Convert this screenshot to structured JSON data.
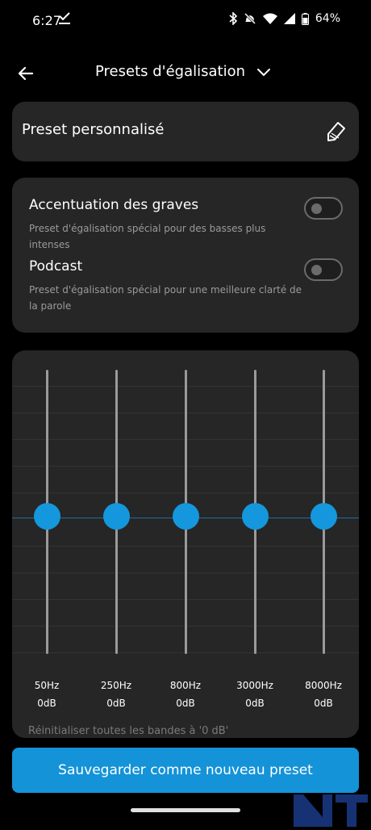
{
  "status_bar": {
    "time": "6:27",
    "battery": "64%"
  },
  "header": {
    "title": "Presets d'égalisation"
  },
  "preset": {
    "label": "Preset personnalisé"
  },
  "toggles": [
    {
      "title": "Accentuation des graves",
      "description": "Preset d'égalisation spécial pour des basses plus intenses",
      "on": false
    },
    {
      "title": "Podcast",
      "description": "Preset d'égalisation spécial pour une meilleure clarté de la parole",
      "on": false
    }
  ],
  "equalizer": {
    "bands": [
      {
        "freq": "50Hz",
        "gain": "0dB"
      },
      {
        "freq": "250Hz",
        "gain": "0dB"
      },
      {
        "freq": "800Hz",
        "gain": "0dB"
      },
      {
        "freq": "3000Hz",
        "gain": "0dB"
      },
      {
        "freq": "8000Hz",
        "gain": "0dB"
      }
    ],
    "reset_label": "Réinitialiser toutes les bandes à '0 dB'"
  },
  "actions": {
    "save_label": "Sauvegarder comme nouveau preset"
  },
  "colors": {
    "accent": "#1493d8",
    "card": "#262626",
    "background": "#000000"
  },
  "icons": {
    "back": "arrow-left-icon",
    "title_dropdown": "chevron-down-icon",
    "edit": "pencil-icon"
  }
}
